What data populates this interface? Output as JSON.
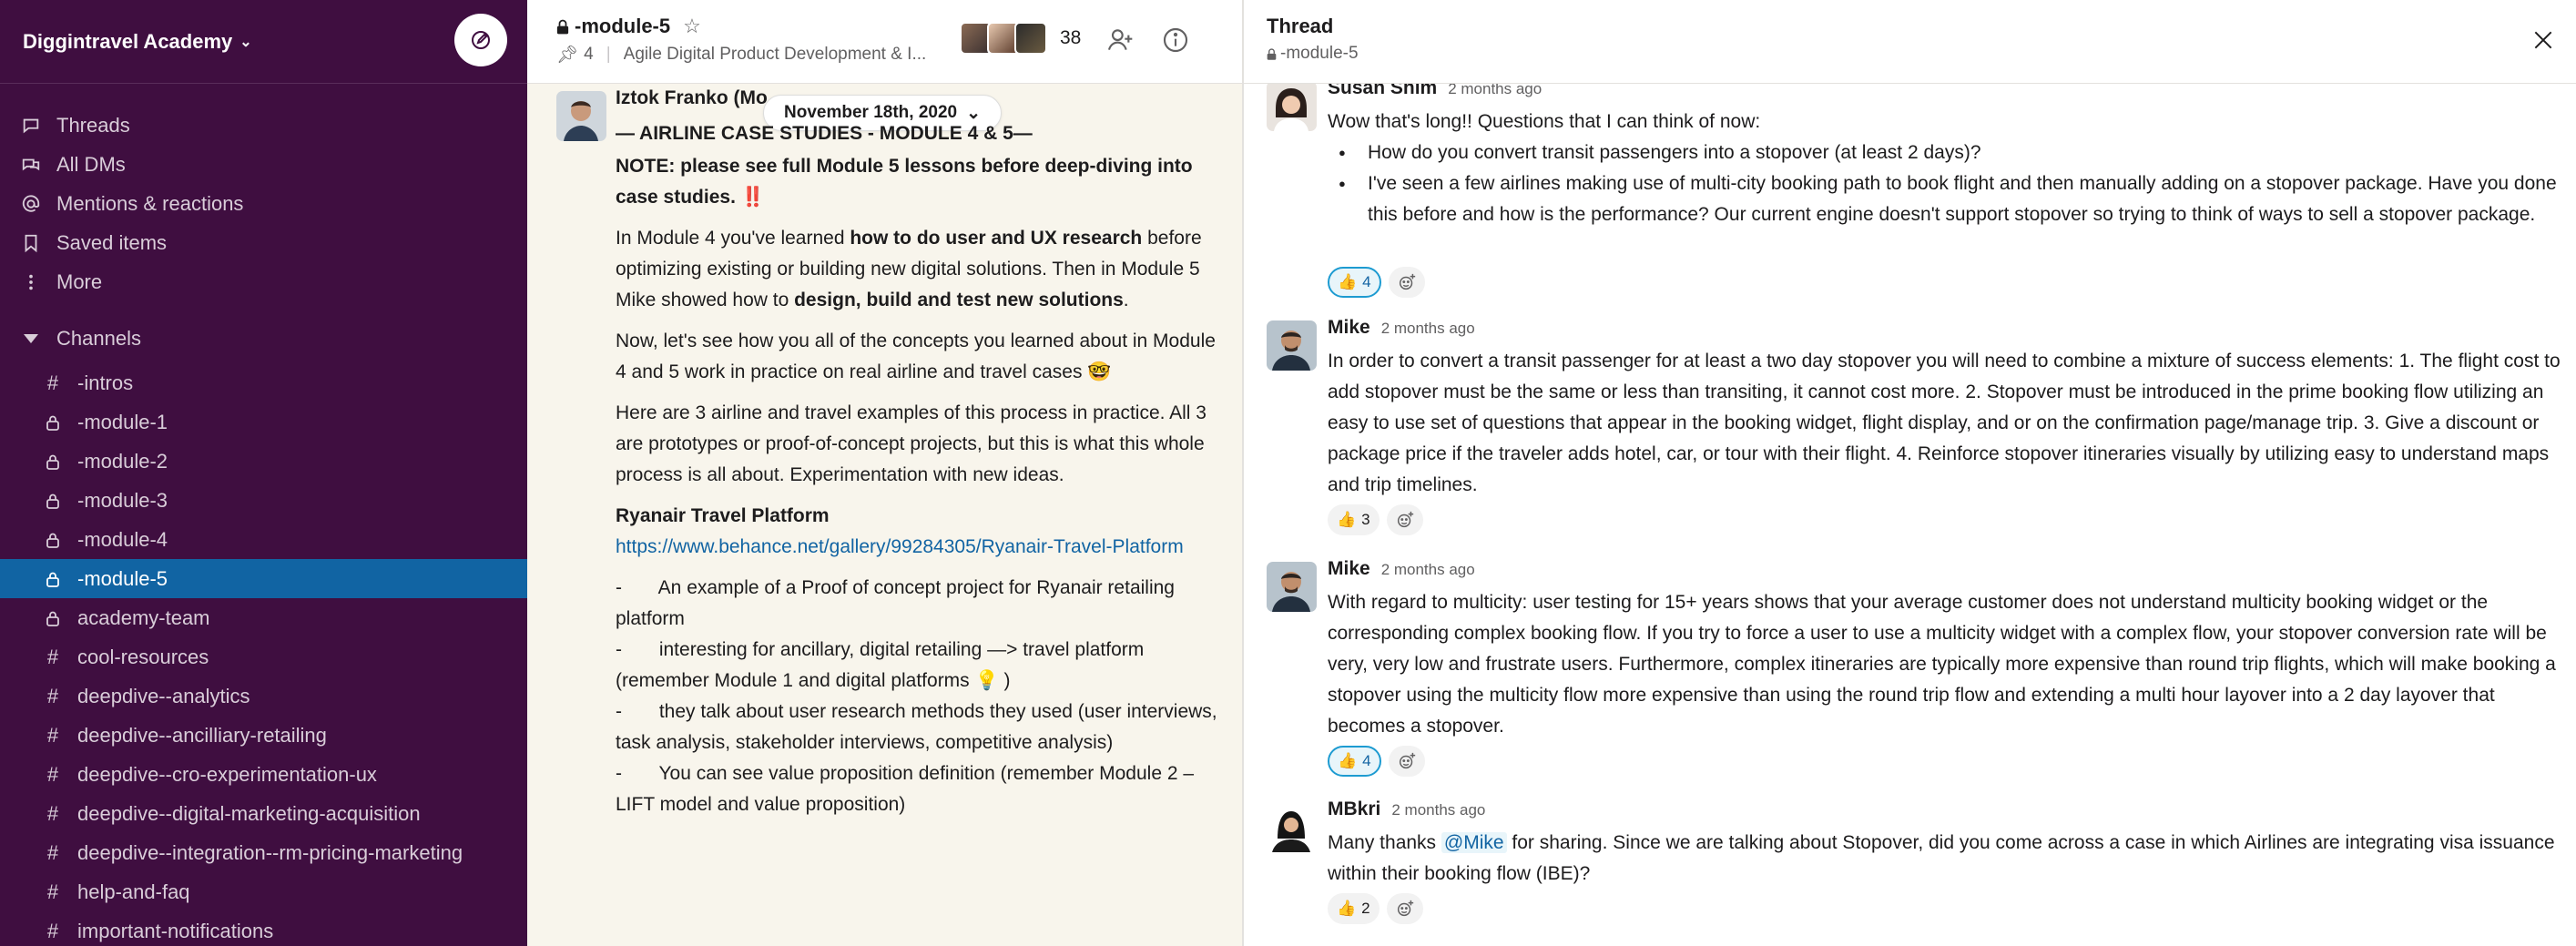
{
  "workspace": {
    "name": "Diggintravel Academy"
  },
  "nav": {
    "items": [
      {
        "label": "Threads",
        "icon": "threads-icon"
      },
      {
        "label": "All DMs",
        "icon": "dms-icon"
      },
      {
        "label": "Mentions & reactions",
        "icon": "at-icon"
      },
      {
        "label": "Saved items",
        "icon": "bookmark-icon"
      },
      {
        "label": "More",
        "icon": "more-icon"
      }
    ]
  },
  "channels": {
    "header": "Channels",
    "items": [
      {
        "prefix": "#",
        "name": "-intros"
      },
      {
        "prefix": "lock",
        "name": "-module-1"
      },
      {
        "prefix": "lock",
        "name": "-module-2"
      },
      {
        "prefix": "lock",
        "name": "-module-3"
      },
      {
        "prefix": "lock",
        "name": "-module-4"
      },
      {
        "prefix": "lock",
        "name": "-module-5",
        "active": true
      },
      {
        "prefix": "lock",
        "name": "academy-team"
      },
      {
        "prefix": "#",
        "name": "cool-resources"
      },
      {
        "prefix": "#",
        "name": "deepdive--analytics"
      },
      {
        "prefix": "#",
        "name": "deepdive--ancilliary-retailing"
      },
      {
        "prefix": "#",
        "name": "deepdive--cro-experimentation-ux"
      },
      {
        "prefix": "#",
        "name": "deepdive--digital-marketing-acquisition"
      },
      {
        "prefix": "#",
        "name": "deepdive--integration--rm-pricing-marketing"
      },
      {
        "prefix": "#",
        "name": "help-and-faq"
      },
      {
        "prefix": "#",
        "name": "important-notifications"
      }
    ]
  },
  "channel_header": {
    "name": "-module-5",
    "pinned_count": "4",
    "description": "Agile Digital Product Development & I...",
    "member_count": "38"
  },
  "channel_message": {
    "author": "Iztok Franko (Mo",
    "date_pill": "November 18th, 2020",
    "line_title": "— AIRLINE CASE STUDIES - MODULE 4 & 5—",
    "note": "NOTE: please see full Module 5 lessons before deep-diving into case studies.",
    "note_emoji": "‼️",
    "p1_a": "In Module 4 you've learned ",
    "p1_b": "how to do user and UX research",
    "p1_c": " before optimizing existing or building new digital solutions. Then in Module 5 Mike showed how to ",
    "p1_d": "design, build and test new solutions",
    "p1_e": ".",
    "p2": "Now, let's see how you all of the concepts you learned about in Module 4 and 5 work in practice on real airline and travel cases",
    "p2_emoji": "🤓",
    "p3": "Here are 3 airline and travel examples of this process in practice. All 3 are prototypes or proof-of-concept projects, but this is what this whole process is all about. Experimentation with new ideas.",
    "case_title": "Ryanair Travel Platform",
    "case_link": "https://www.behance.net/gallery/99284305/Ryanair-Travel-Platform",
    "bullet1": "-       An example of a Proof of concept project for Ryanair retailing platform",
    "bullet2": "-       interesting for ancillary, digital retailing —> travel platform (remember Module 1 and digital platforms",
    "bullet2_emoji": "💡",
    "bullet2_end": ")",
    "bullet3": "-       they talk about user research methods they used (user interviews, task analysis, stakeholder interviews, competitive analysis)",
    "bullet4": "-       You can see value proposition definition (remember Module 2 – LIFT model and value proposition)"
  },
  "thread": {
    "title": "Thread",
    "channel": "-module-5",
    "replies": [
      {
        "name": "Susan Shim",
        "time": "2 months ago",
        "intro": "Wow that's long!! Questions that I can think of now:",
        "bullets": [
          "How do you convert transit passengers into a stopover (at least 2 days)?",
          "I've seen a few airlines making use of multi-city booking path to book flight and then manually adding on a stopover package. Have you done this before and how is the performance? Our current engine doesn't support stopover so trying to think of ways to sell a stopover package."
        ],
        "reaction": {
          "emoji": "👍",
          "count": "4",
          "mine": true
        }
      },
      {
        "name": "Mike",
        "time": "2 months ago",
        "text": "In order to convert a transit passenger for at least a two day stopover you will need to combine a mixture of success elements: 1. The flight cost to add stopover must be the same or less than transiting, it cannot cost more. 2. Stopover must be introduced in the prime booking flow utilizing an easy to use set of questions that appear in the booking widget, flight display, and or on the confirmation page/manage trip. 3. Give a discount or package price if the traveler adds hotel, car, or tour with their flight. 4. Reinforce stopover itineraries visually by utilizing easy to understand maps and trip timelines.",
        "reaction": {
          "emoji": "👍",
          "count": "3",
          "mine": false
        }
      },
      {
        "name": "Mike",
        "time": "2 months ago",
        "text": "With regard to multicity: user testing for 15+ years shows that your average customer does not understand multicity booking widget or the corresponding complex booking flow. If you try to force a user to use a multicity widget with a complex flow, your stopover conversion rate will be very, very low and frustrate users. Furthermore, complex itineraries are typically more expensive than round trip flights, which will make booking a stopover using the multicity flow more expensive than using the round trip flow and extending a multi hour layover into a 2 day layover that becomes a stopover.",
        "reaction": {
          "emoji": "👍",
          "count": "4",
          "mine": true
        }
      },
      {
        "name": "MBkri",
        "time": "2 months ago",
        "text_a": "Many thanks ",
        "mention": "@Mike",
        "text_b": " for sharing. Since we are talking about Stopover, did you come across a case in which Airlines are integrating visa issuance within their booking flow (IBE)?",
        "reaction": {
          "emoji": "👍",
          "count": "2",
          "mine": false
        }
      }
    ]
  },
  "colors": {
    "sidebar_bg": "#3f0e40",
    "active_channel": "#1164a3",
    "link": "#1264a3",
    "channel_pane_bg": "#f8f5ec"
  }
}
